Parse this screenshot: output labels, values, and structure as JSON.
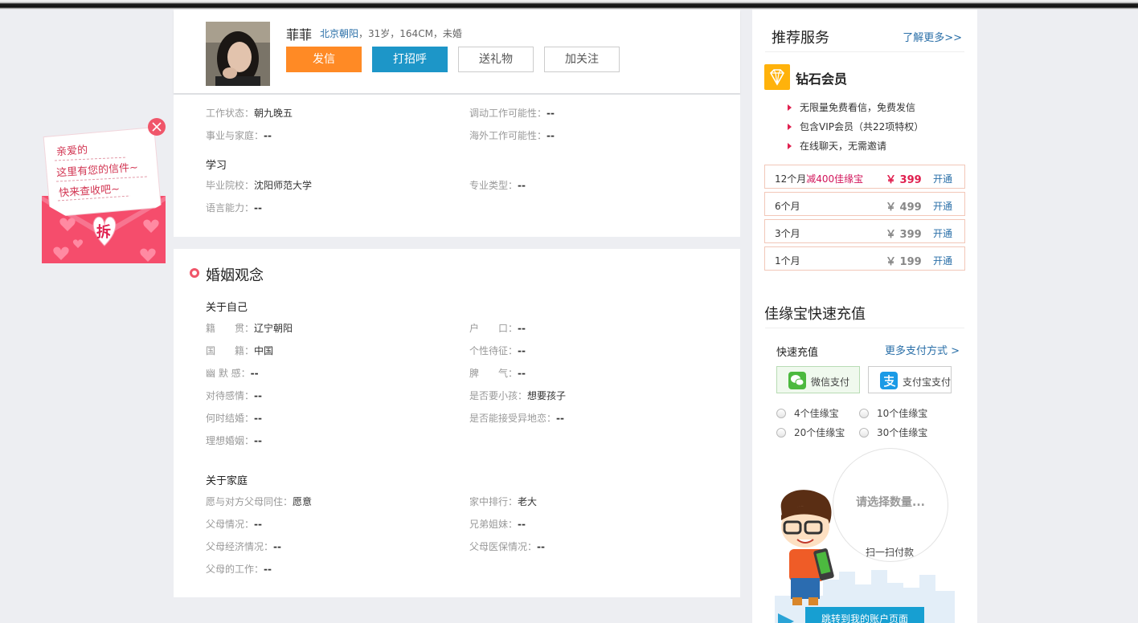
{
  "profile": {
    "name": "菲菲",
    "city": "北京朝阳",
    "details": "，31岁，164CM，未婚",
    "buttons": {
      "send": "发信",
      "greet": "打招呼",
      "gift": "送礼物",
      "follow": "加关注"
    }
  },
  "work": {
    "status_label": "工作状态：",
    "status_value": "朝九晚五",
    "transfer_label": "调动工作可能性：",
    "transfer_value": "--",
    "career_family_label": "事业与家庭：",
    "career_family_value": "--",
    "overseas_label": "海外工作可能性：",
    "overseas_value": "--"
  },
  "study": {
    "heading": "学习",
    "school_label": "毕业院校：",
    "school_value": "沈阳师范大学",
    "major_label": "专业类型：",
    "major_value": "--",
    "language_label": "语言能力：",
    "language_value": "--"
  },
  "marriage": {
    "title": "婚姻观念",
    "self_heading": "关于自己",
    "self_rows": [
      {
        "l1": "籍　　贯：",
        "v1": "辽宁朝阳",
        "l2": "户　　口：",
        "v2": "--"
      },
      {
        "l1": "国　　籍：",
        "v1": "中国",
        "l2": "个性待征：",
        "v2": "--"
      },
      {
        "l1": "幽 默 感：",
        "v1": "--",
        "l2": "脾　　气：",
        "v2": "--"
      },
      {
        "l1": "对待感情：",
        "v1": "--",
        "l2": "是否要小孩：",
        "v2": "想要孩子"
      },
      {
        "l1": "何时结婚：",
        "v1": "--",
        "l2": "是否能接受异地恋：",
        "v2": "--"
      },
      {
        "l1": "理想婚姻：",
        "v1": "--"
      }
    ],
    "family_heading": "关于家庭",
    "family_rows": [
      {
        "l1": "愿与对方父母同住：",
        "v1": "愿意",
        "l2": "家中排行：",
        "v2": "老大"
      },
      {
        "l1": "父母情况：",
        "v1": "--",
        "l2": "兄弟姐妹：",
        "v2": "--"
      },
      {
        "l1": "父母经济情况：",
        "v1": "--",
        "l2": "父母医保情况：",
        "v2": "--"
      },
      {
        "l1": "父母的工作：",
        "v1": "--"
      }
    ]
  },
  "letter": {
    "line1": "亲爱的",
    "line2": "这里有您的信件~",
    "line3": "快来查收吧~",
    "open": "拆"
  },
  "sidebar": {
    "title": "推荐服务",
    "more": "了解更多>>",
    "vip_name": "钻石会员",
    "benefits": [
      "无限量免费看信，免费发信",
      "包含VIP会员（共22项特权）",
      "在线聊天，无需邀请"
    ],
    "plans": [
      {
        "months": "12个月",
        "promo": "减400佳缘宝",
        "price": "￥ 399",
        "action": "开通"
      },
      {
        "months": "6个月",
        "promo": "",
        "price": "￥ 499",
        "action": "开通"
      },
      {
        "months": "3个月",
        "promo": "",
        "price": "￥ 399",
        "action": "开通"
      },
      {
        "months": "1个月",
        "promo": "",
        "price": "￥ 199",
        "action": "开通"
      }
    ],
    "recharge_title": "佳缘宝快速充值",
    "quick": "快速充值",
    "more_pay": "更多支付方式 >",
    "wechat": "微信支付",
    "alipay": "支付宝支付",
    "amounts": [
      "4个佳缘宝",
      "10个佳缘宝",
      "20个佳缘宝",
      "30个佳缘宝"
    ],
    "select_hint": "请选择数量...",
    "scan": "扫一扫付款",
    "jump": "跳转到我的账户页面"
  },
  "colors": {
    "orange": "#ff8a25",
    "blue": "#1d96c8",
    "pink": "#f0566a",
    "link": "#2a6fa8"
  }
}
